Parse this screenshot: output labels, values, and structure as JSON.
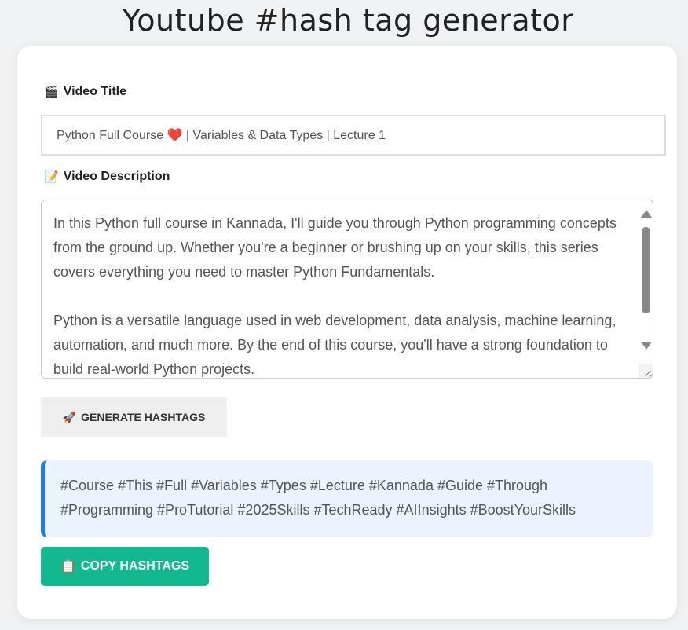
{
  "page_title": "Youtube #hash tag generator",
  "form": {
    "title_label": "Video Title",
    "title_icon": "🎬",
    "title_value": "Python Full Course ❤️ | Variables & Data Types | Lecture 1",
    "description_label": "Video Description",
    "description_icon": "📝",
    "description_value": "In this Python full course in Kannada, I'll guide you through Python programming concepts from the ground up. Whether you're a beginner or brushing up on your skills, this series covers everything you need to master Python Fundamentals.\n\nPython is a versatile language used in web development, data analysis, machine learning, automation, and much more. By the end of this course, you'll have a strong foundation to build real-world Python projects."
  },
  "generate_button": {
    "icon": "🚀",
    "label": "GENERATE HASHTAGS"
  },
  "result": {
    "hashtags": "#Course #This #Full #Variables #Types #Lecture #Kannada #Guide #Through #Programming #ProTutorial #2025Skills #TechReady #AIInsights #BoostYourSkills",
    "accent_color": "#1a7cf2",
    "background_color": "#eaf3fe"
  },
  "copy_button": {
    "icon": "📋",
    "label": "COPY HASHTAGS",
    "color": "#14b88f"
  }
}
